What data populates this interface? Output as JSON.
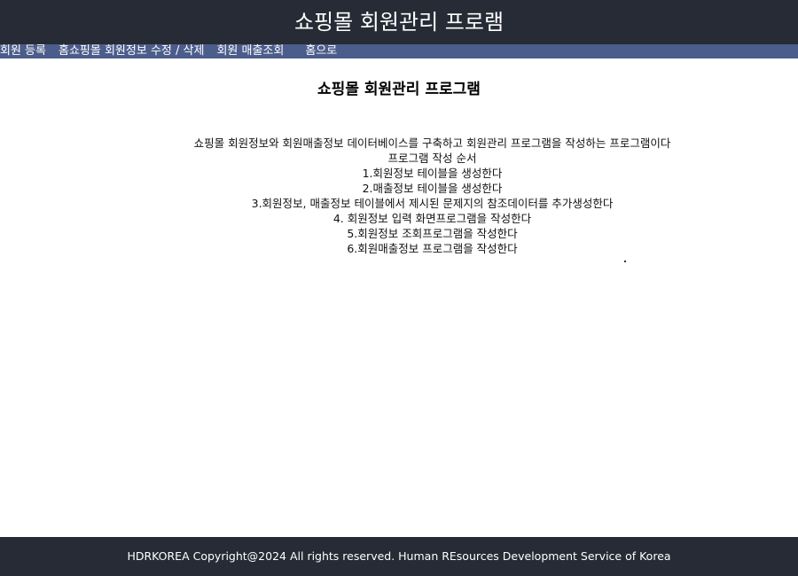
{
  "header": {
    "title": "쇼핑몰 회원관리 프로램"
  },
  "nav": {
    "items": [
      {
        "label": "회원 등록"
      },
      {
        "label": "홈"
      },
      {
        "label": "쇼핑몰 회원정보 수정 / 삭제"
      },
      {
        "label": "회원 매출조회"
      },
      {
        "label": "홈으로"
      }
    ]
  },
  "main": {
    "title": "쇼핑몰 회원관리 프로그램",
    "lines": [
      "쇼핑몰 회원정보와 회원매출정보 데이터베이스를 구축하고 회원관리 프로그램을 작성하는 프로그램이다",
      "프로그램 작성 순서",
      "1.회원정보 테이블을 생성한다",
      "2.매출정보 테이블을 생성한다",
      "3.회원정보, 매출정보 테이블에서 제시된 문제지의 참조데이터를 추가생성한다",
      "4. 회원정보 입력 화면프로그램을 작성한다",
      "5.회원정보 조회프로그램을 작성한다",
      "6.회원매출정보 프로그램을 작성한다"
    ]
  },
  "footer": {
    "text": "HDRKOREA Copyright@2024 All rights reserved. Human REsources Development Service of Korea"
  },
  "colors": {
    "header_bg": "#262b35",
    "nav_bg": "#4b5d8b",
    "footer_bg": "#262b35",
    "text_light": "#ffffff"
  }
}
